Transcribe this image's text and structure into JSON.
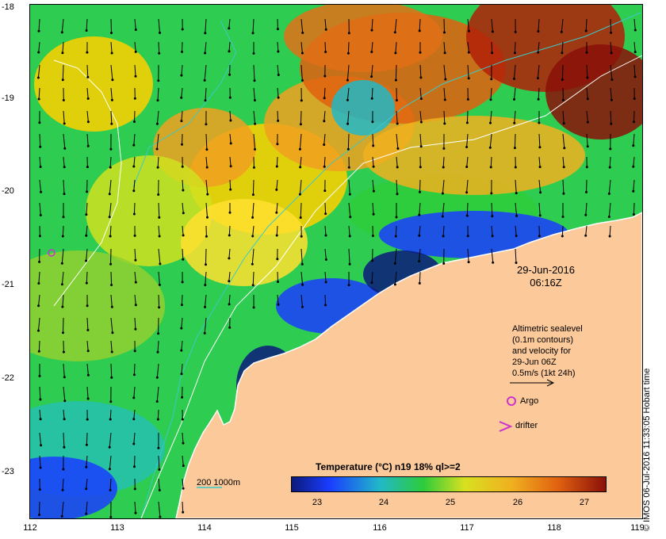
{
  "timestamp": {
    "date": "29-Jun-2016",
    "time": "06:16Z"
  },
  "legend": {
    "lines": [
      "Altimetric sealevel",
      "(0.1m contours)",
      "and velocity for",
      "29-Jun 06Z",
      "0.5m/s (1kt 24h)"
    ],
    "argo_label": "Argo",
    "drifter_label": "drifter",
    "contour_key": "200  1000m"
  },
  "colorbar": {
    "title": "Temperature (°C) n19 18% ql>=2",
    "ticks": [
      "23",
      "24",
      "25",
      "26",
      "27"
    ],
    "tick_values": [
      23,
      24,
      25,
      26,
      27
    ],
    "range": [
      22.6,
      27.3
    ]
  },
  "axes": {
    "x_ticks": [
      "112",
      "113",
      "114",
      "115",
      "116",
      "117",
      "118",
      "119"
    ],
    "y_ticks": [
      "-18",
      "-19",
      "-20",
      "-21",
      "-22",
      "-23"
    ],
    "lon_range": [
      112,
      119
    ],
    "lat_range": [
      -18,
      -23.5
    ]
  },
  "credit": "© IMOS 06-Jul-2016 11:33:05 Hobart time",
  "colors": {
    "land": "#fbc99a",
    "coast": "#ffffff",
    "contour_200": "#3ec8c8",
    "contour_1000": "#ffffff",
    "argo": "#cc33cc",
    "drifter": "#cc33cc"
  }
}
